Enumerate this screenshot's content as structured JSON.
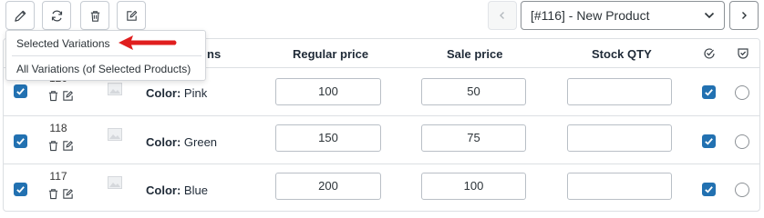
{
  "toolbar": {
    "buttons": [
      {
        "icon": "pencil-icon"
      },
      {
        "icon": "refresh-icon"
      },
      {
        "icon": "trash-icon"
      },
      {
        "icon": "edit-square-icon"
      }
    ]
  },
  "product_nav": {
    "selected": "[#116] - New Product",
    "prev_icon": "chevron-left-icon",
    "next_icon": "chevron-right-icon"
  },
  "dropdown": {
    "items": [
      "Selected Variations",
      "All Variations (of Selected Products)"
    ]
  },
  "table": {
    "headers": {
      "variations_partial": "ns",
      "regular_price": "Regular price",
      "sale_price": "Sale price",
      "stock_qty": "Stock QTY"
    },
    "rows": [
      {
        "id": "120",
        "attr": "Color:",
        "value": "Pink",
        "regular": "100",
        "sale": "50",
        "stock": ""
      },
      {
        "id": "118",
        "attr": "Color:",
        "value": "Green",
        "regular": "150",
        "sale": "75",
        "stock": ""
      },
      {
        "id": "117",
        "attr": "Color:",
        "value": "Blue",
        "regular": "200",
        "sale": "100",
        "stock": ""
      }
    ]
  },
  "colors": {
    "accent": "#2271b1",
    "arrow": "#e01e1e",
    "border": "#dcdfe3"
  }
}
